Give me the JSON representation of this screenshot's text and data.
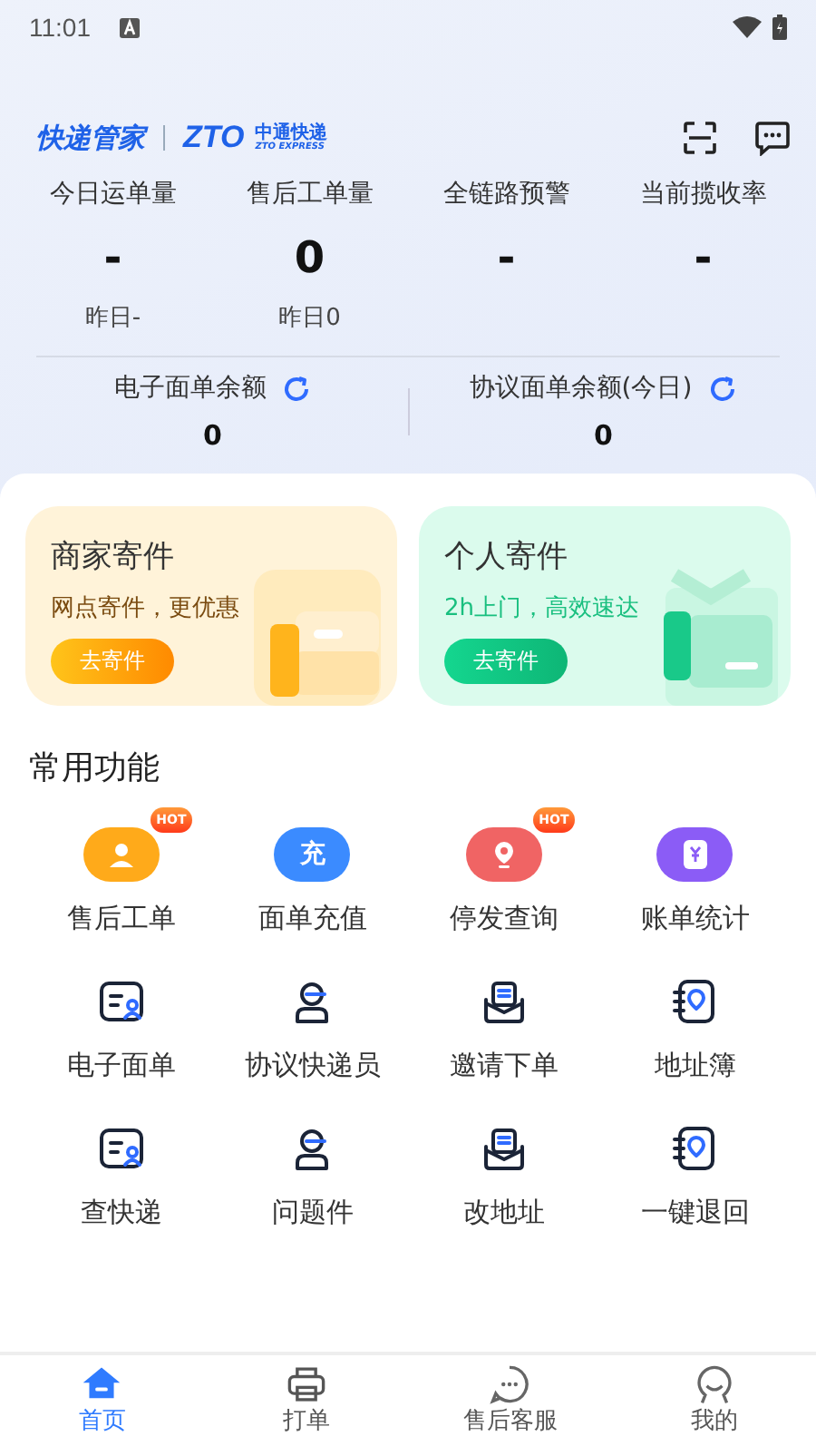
{
  "status_bar": {
    "time": "11:01"
  },
  "header": {
    "app_name": "快递管家",
    "brand": "中通快递",
    "brand_mark": "ZTO",
    "brand_sub": "ZTO EXPRESS"
  },
  "stats": [
    {
      "label": "今日运单量",
      "value": "-",
      "yesterday": "昨日-"
    },
    {
      "label": "售后工单量",
      "value": "0",
      "yesterday": "昨日0"
    },
    {
      "label": "全链路预警",
      "value": "-"
    },
    {
      "label": "当前揽收率",
      "value": "-"
    }
  ],
  "balances": [
    {
      "label": "电子面单余额",
      "value": "0"
    },
    {
      "label": "协议面单余额(今日)",
      "value": "0"
    }
  ],
  "cards": [
    {
      "kind": "merchant",
      "title": "商家寄件",
      "subtitle": "网点寄件，更优惠",
      "button": "去寄件"
    },
    {
      "kind": "personal",
      "title": "个人寄件",
      "subtitle": "2h上门，高效速达",
      "button": "去寄件"
    }
  ],
  "section_title": "常用功能",
  "functions": [
    {
      "kind": "badge",
      "label": "售后工单",
      "color": "#ffaa1a",
      "hot": "HOT"
    },
    {
      "kind": "badge",
      "label": "面单充值",
      "color": "#3b8bff",
      "glyph": "充"
    },
    {
      "kind": "badge",
      "label": "停发查询",
      "color": "#f06464",
      "hot": "HOT"
    },
    {
      "kind": "badge",
      "label": "账单统计",
      "color": "#8b5cf6"
    },
    {
      "kind": "outline",
      "label": "电子面单"
    },
    {
      "kind": "outline",
      "label": "协议快递员"
    },
    {
      "kind": "outline",
      "label": "邀请下单"
    },
    {
      "kind": "outline",
      "label": "地址簿"
    },
    {
      "kind": "outline",
      "label": "查快递"
    },
    {
      "kind": "outline",
      "label": "问题件"
    },
    {
      "kind": "outline",
      "label": "改地址"
    },
    {
      "kind": "outline",
      "label": "一键退回"
    }
  ],
  "tabs": [
    {
      "label": "首页",
      "selected": true
    },
    {
      "label": "打单",
      "selected": false
    },
    {
      "label": "售后客服",
      "selected": false
    },
    {
      "label": "我的",
      "selected": false
    }
  ]
}
